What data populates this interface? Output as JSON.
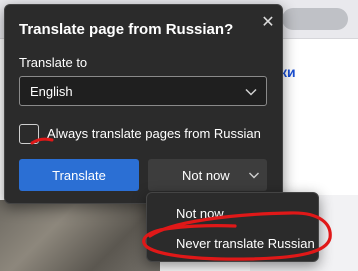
{
  "background": {
    "link_fragment": "ки"
  },
  "dialog": {
    "title": "Translate page from Russian?",
    "close_icon": "close-icon",
    "translate_to_label": "Translate to",
    "language_select": {
      "value": "English"
    },
    "always_translate": {
      "label": "Always translate pages from Russian",
      "checked": false
    },
    "translate_button": "Translate",
    "not_now_button": "Not now"
  },
  "menu": {
    "items": [
      {
        "label": "Not now"
      },
      {
        "label": "Never translate Russian"
      }
    ]
  },
  "colors": {
    "accent": "#2b6fd4",
    "flyout_bg": "#2b2b2b",
    "annotation": "#e01818"
  }
}
